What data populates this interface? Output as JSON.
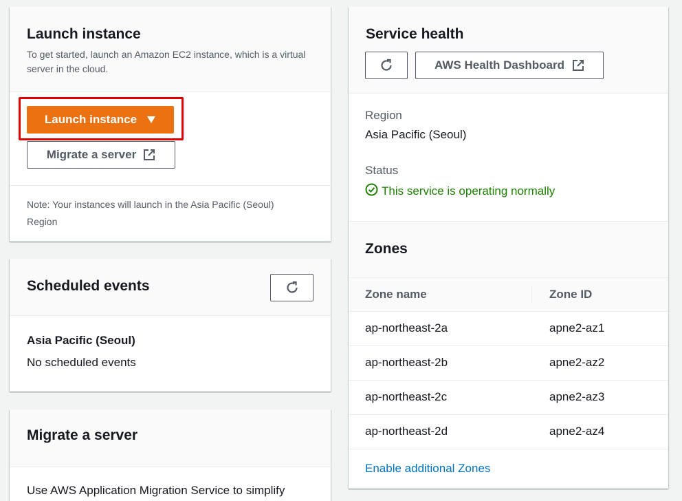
{
  "launch_card": {
    "title": "Launch instance",
    "description": "To get started, launch an Amazon EC2 instance, which is a virtual server in the cloud.",
    "launch_button_label": "Launch instance",
    "migrate_button_label": "Migrate a server",
    "note": "Note: Your instances will launch in the Asia Pacific (Seoul) Region"
  },
  "scheduled_events": {
    "title": "Scheduled events",
    "region": "Asia Pacific (Seoul)",
    "message": "No scheduled events"
  },
  "migrate_card": {
    "title": "Migrate a server",
    "body": "Use AWS Application Migration Service to simplify"
  },
  "service_health": {
    "title": "Service health",
    "dashboard_button_label": "AWS Health Dashboard",
    "region_label": "Region",
    "region_value": "Asia Pacific (Seoul)",
    "status_label": "Status",
    "status_value": "This service is operating normally"
  },
  "zones": {
    "title": "Zones",
    "columns": [
      "Zone name",
      "Zone ID"
    ],
    "rows": [
      {
        "name": "ap-northeast-2a",
        "id": "apne2-az1"
      },
      {
        "name": "ap-northeast-2b",
        "id": "apne2-az2"
      },
      {
        "name": "ap-northeast-2c",
        "id": "apne2-az3"
      },
      {
        "name": "ap-northeast-2d",
        "id": "apne2-az4"
      }
    ],
    "enable_link": "Enable additional Zones"
  },
  "colors": {
    "primary": "#ec7211",
    "link": "#0073bb",
    "success": "#1d8102",
    "highlight": "#e00000"
  },
  "icons": {
    "refresh": "refresh-icon",
    "external": "external-link-icon",
    "caret": "caret-down-icon",
    "status": "check-circle-icon"
  }
}
